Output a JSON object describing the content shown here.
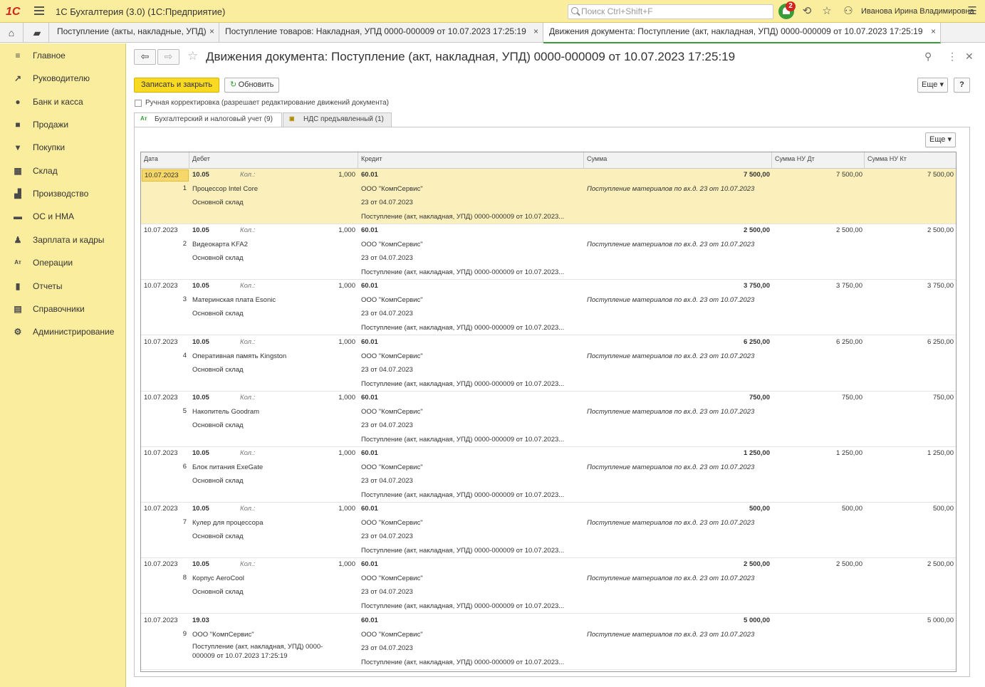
{
  "app": {
    "logo": "1С",
    "title": "1С Бухгалтерия (3.0)  (1С:Предприятие)",
    "search_placeholder": "Поиск Ctrl+Shift+F",
    "notifications": "2",
    "user": "Иванова Ирина Владимировна"
  },
  "tabs": [
    {
      "label": "Поступление (акты, накладные, УПД)"
    },
    {
      "label": "Поступление товаров: Накладная, УПД 0000-000009 от 10.07.2023 17:25:19"
    },
    {
      "label": "Движения документа: Поступление (акт, накладная, УПД) 0000-000009 от 10.07.2023 17:25:19"
    }
  ],
  "tab_close": "×",
  "sidebar": [
    {
      "icon": "menu-icon",
      "label": "Главное"
    },
    {
      "icon": "trend-icon",
      "label": "Руководителю"
    },
    {
      "icon": "coin-icon",
      "label": "Банк и касса"
    },
    {
      "icon": "bag-icon",
      "label": "Продажи"
    },
    {
      "icon": "cart-icon",
      "label": "Покупки"
    },
    {
      "icon": "warehouse-icon",
      "label": "Склад"
    },
    {
      "icon": "factory-icon",
      "label": "Производство"
    },
    {
      "icon": "truck-icon",
      "label": "ОС и НМА"
    },
    {
      "icon": "person-icon",
      "label": "Зарплата и кадры"
    },
    {
      "icon": "dtkt-icon",
      "label": "Операции"
    },
    {
      "icon": "bars-icon",
      "label": "Отчеты"
    },
    {
      "icon": "book-icon",
      "label": "Справочники"
    },
    {
      "icon": "gear-icon",
      "label": "Администрирование"
    }
  ],
  "document": {
    "title": "Движения документа: Поступление (акт, накладная, УПД) 0000-000009 от 10.07.2023 17:25:19",
    "save_close": "Записать и закрыть",
    "refresh": "Обновить",
    "more": "Еще",
    "help": "?",
    "manual_label": "Ручная корректировка (разрешает редактирование движений документа)",
    "register_tabs": [
      {
        "label": "Бухгалтерский и налоговый учет (9)"
      },
      {
        "label": "НДС предъявленный (1)"
      }
    ],
    "grid_more": "Еще"
  },
  "table": {
    "headers": [
      "Дата",
      "Дебет",
      "Кредит",
      "Сумма",
      "Сумма НУ Дт",
      "Сумма НУ Кт"
    ],
    "qty_label": "Кол.:",
    "rows": [
      {
        "date": "10.07.2023",
        "n": "1",
        "debit": "10.05",
        "qty": "1,000",
        "item": "Процессор Intel Core",
        "sub2": "Основной склад",
        "credit": "60.01",
        "c1": "ООО \"КомпСервис\"",
        "c2": "23 от 04.07.2023",
        "c3": "Поступление (акт, накладная, УПД) 0000-000009 от 10.07.2023...",
        "sum": "7 500,00",
        "desc": "Поступление материалов по вх.д. 23 от 10.07.2023",
        "nudt": "7 500,00",
        "nukt": "7 500,00"
      },
      {
        "date": "10.07.2023",
        "n": "2",
        "debit": "10.05",
        "qty": "1,000",
        "item": "Видеокарта KFA2",
        "sub2": "Основной склад",
        "credit": "60.01",
        "c1": "ООО \"КомпСервис\"",
        "c2": "23 от 04.07.2023",
        "c3": "Поступление (акт, накладная, УПД) 0000-000009 от 10.07.2023...",
        "sum": "2 500,00",
        "desc": "Поступление материалов по вх.д. 23 от 10.07.2023",
        "nudt": "2 500,00",
        "nukt": "2 500,00"
      },
      {
        "date": "10.07.2023",
        "n": "3",
        "debit": "10.05",
        "qty": "1,000",
        "item": "Материнская плата Esonic",
        "sub2": "Основной склад",
        "credit": "60.01",
        "c1": "ООО \"КомпСервис\"",
        "c2": "23 от 04.07.2023",
        "c3": "Поступление (акт, накладная, УПД) 0000-000009 от 10.07.2023...",
        "sum": "3 750,00",
        "desc": "Поступление материалов по вх.д. 23 от 10.07.2023",
        "nudt": "3 750,00",
        "nukt": "3 750,00"
      },
      {
        "date": "10.07.2023",
        "n": "4",
        "debit": "10.05",
        "qty": "1,000",
        "item": "Оперативная память Kingston",
        "sub2": "Основной склад",
        "credit": "60.01",
        "c1": "ООО \"КомпСервис\"",
        "c2": "23 от 04.07.2023",
        "c3": "Поступление (акт, накладная, УПД) 0000-000009 от 10.07.2023...",
        "sum": "6 250,00",
        "desc": "Поступление материалов по вх.д. 23 от 10.07.2023",
        "nudt": "6 250,00",
        "nukt": "6 250,00"
      },
      {
        "date": "10.07.2023",
        "n": "5",
        "debit": "10.05",
        "qty": "1,000",
        "item": "Накопитель Goodram",
        "sub2": "Основной склад",
        "credit": "60.01",
        "c1": "ООО \"КомпСервис\"",
        "c2": "23 от 04.07.2023",
        "c3": "Поступление (акт, накладная, УПД) 0000-000009 от 10.07.2023...",
        "sum": "750,00",
        "desc": "Поступление материалов по вх.д. 23 от 10.07.2023",
        "nudt": "750,00",
        "nukt": "750,00"
      },
      {
        "date": "10.07.2023",
        "n": "6",
        "debit": "10.05",
        "qty": "1,000",
        "item": "Блок питания ExeGate",
        "sub2": "Основной склад",
        "credit": "60.01",
        "c1": "ООО \"КомпСервис\"",
        "c2": "23 от 04.07.2023",
        "c3": "Поступление (акт, накладная, УПД) 0000-000009 от 10.07.2023...",
        "sum": "1 250,00",
        "desc": "Поступление материалов по вх.д. 23 от 10.07.2023",
        "nudt": "1 250,00",
        "nukt": "1 250,00"
      },
      {
        "date": "10.07.2023",
        "n": "7",
        "debit": "10.05",
        "qty": "1,000",
        "item": "Кулер для процессора",
        "sub2": "Основной склад",
        "credit": "60.01",
        "c1": "ООО \"КомпСервис\"",
        "c2": "23 от 04.07.2023",
        "c3": "Поступление (акт, накладная, УПД) 0000-000009 от 10.07.2023...",
        "sum": "500,00",
        "desc": "Поступление материалов по вх.д. 23 от 10.07.2023",
        "nudt": "500,00",
        "nukt": "500,00"
      },
      {
        "date": "10.07.2023",
        "n": "8",
        "debit": "10.05",
        "qty": "1,000",
        "item": "Корпус AeroCool",
        "sub2": "Основной склад",
        "credit": "60.01",
        "c1": "ООО \"КомпСервис\"",
        "c2": "23 от 04.07.2023",
        "c3": "Поступление (акт, накладная, УПД) 0000-000009 от 10.07.2023...",
        "sum": "2 500,00",
        "desc": "Поступление материалов по вх.д. 23 от 10.07.2023",
        "nudt": "2 500,00",
        "nukt": "2 500,00"
      },
      {
        "date": "10.07.2023",
        "n": "9",
        "debit": "19.03",
        "qty": "",
        "item": "ООО \"КомпСервис\"",
        "sub2": "Поступление (акт, накладная, УПД) 0000-",
        "sub3": "000009 от 10.07.2023 17:25:19",
        "credit": "60.01",
        "c1": "ООО \"КомпСервис\"",
        "c2": "23 от 04.07.2023",
        "c3": "Поступление (акт, накладная, УПД) 0000-000009 от 10.07.2023...",
        "sum": "5 000,00",
        "desc": "Поступление материалов по вх.д. 23 от 10.07.2023",
        "nudt": "",
        "nukt": "5 000,00"
      }
    ]
  }
}
